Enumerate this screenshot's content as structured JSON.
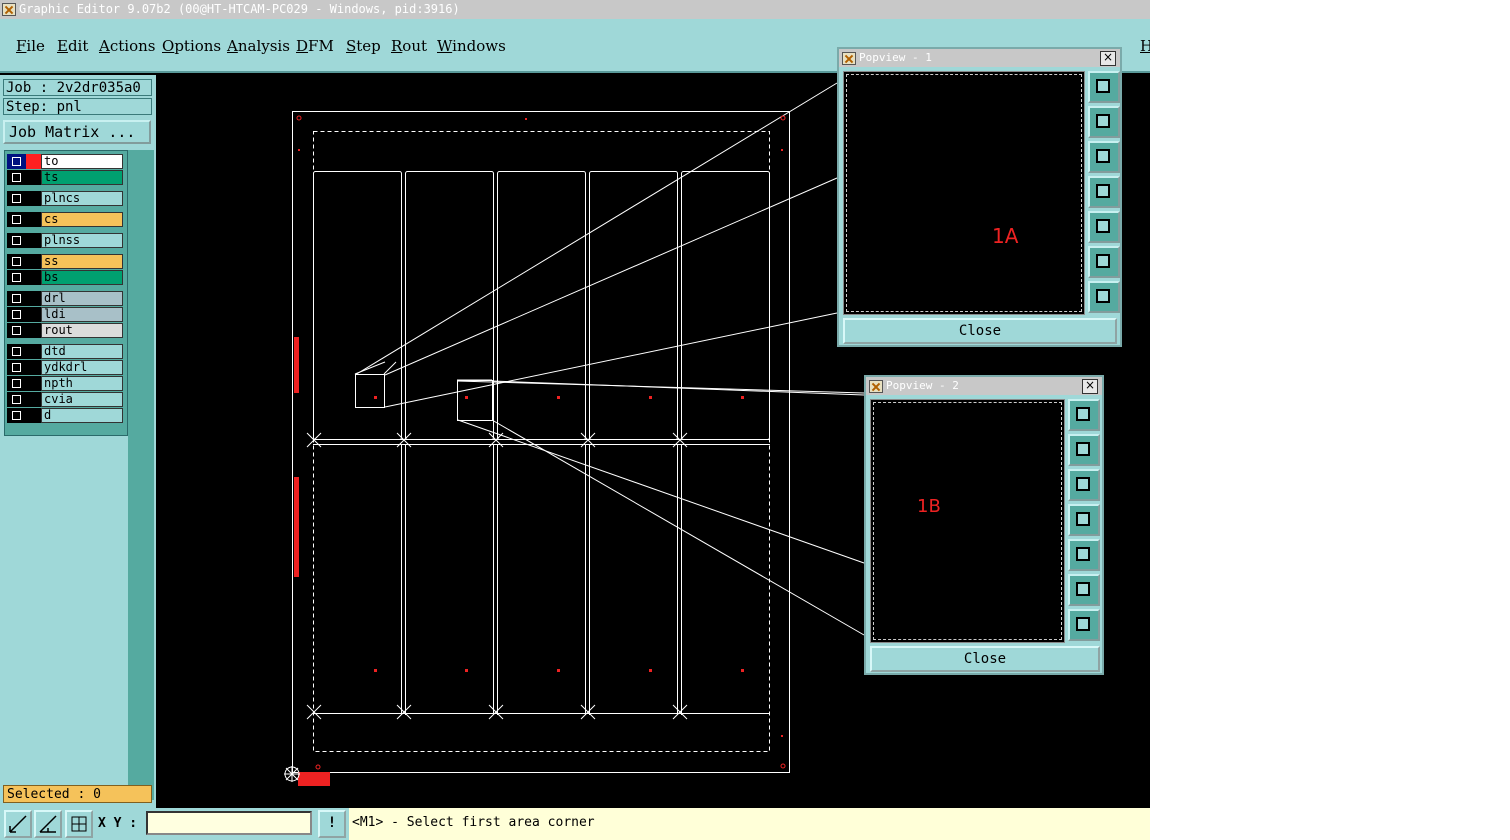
{
  "window": {
    "title": "Graphic Editor 9.07b2 (00@HT-HTCAM-PC029 - Windows, pid:3916)"
  },
  "menu": {
    "items": [
      "File",
      "Edit",
      "Actions",
      "Options",
      "Analysis",
      "DFM",
      "Step",
      "Rout",
      "Windows"
    ],
    "help_partial": "H"
  },
  "job": {
    "job_label": "Job : 2v2dr035a0",
    "step_label": "Step: pnl",
    "matrix_button": "Job Matrix ..."
  },
  "layers": [
    {
      "name": "to",
      "color": "#ffffff",
      "swatch": "#ff2020",
      "active": true
    },
    {
      "name": "ts",
      "color": "#00a070"
    },
    {
      "name": "plncs",
      "color": "#9fd8d8"
    },
    {
      "name": "cs",
      "color": "#f5c25a"
    },
    {
      "name": "plnss",
      "color": "#9fd8d8"
    },
    {
      "name": "ss",
      "color": "#f5c25a"
    },
    {
      "name": "bs",
      "color": "#00a070"
    },
    {
      "name": "drl",
      "color": "#a8c0c8"
    },
    {
      "name": "ldi",
      "color": "#a8c0c8"
    },
    {
      "name": "rout",
      "color": "#dcdcdc"
    },
    {
      "name": "dtd",
      "color": "#9fd8d8"
    },
    {
      "name": "ydkdrl",
      "color": "#9fd8d8"
    },
    {
      "name": "npth",
      "color": "#9fd8d8"
    },
    {
      "name": "cvia",
      "color": "#9fd8d8"
    },
    {
      "name": "d",
      "color": "#9fd8d8"
    }
  ],
  "selected": "Selected : 0",
  "bottom": {
    "xy_label": "X Y :",
    "xy_value": "",
    "status": "<M1> - Select first area corner",
    "alert_glyph": "!"
  },
  "popview1": {
    "title": "Popview - 1",
    "label": "1A",
    "close": "Close",
    "close_glyph": "×"
  },
  "popview2": {
    "title": "Popview - 2",
    "label": "1B",
    "close": "Close",
    "close_glyph": "×"
  },
  "popview_tools": [
    "zoom-window-icon",
    "pan-up-icon",
    "pan-down-icon",
    "pan-left-icon",
    "pan-right-icon",
    "zoom-out-icon",
    "zoom-home-icon"
  ],
  "colors": {
    "accent": "#9fd8d8",
    "dark_teal": "#55aaa0",
    "marker_red": "#ee2222",
    "canvas": "#000000"
  }
}
